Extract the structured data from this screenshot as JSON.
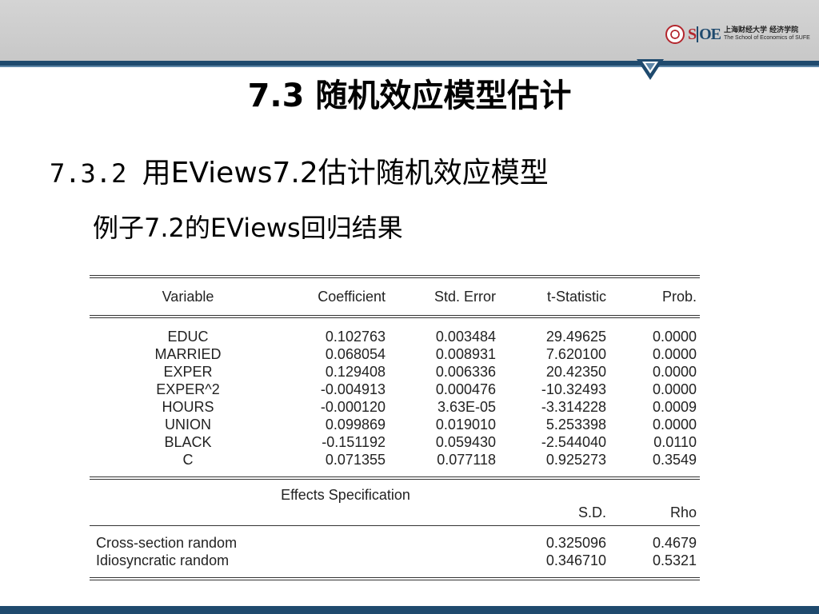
{
  "header": {
    "logo_cn": "上海财经大学 经济学院",
    "logo_en": "The School of Economics of SUFE"
  },
  "slide": {
    "title": "7.3 随机效应模型估计",
    "subtitle_num": "7.3.2 ",
    "subtitle_text": "用EViews7.2估计随机效应模型",
    "caption": "例子7.2的EViews回归结果"
  },
  "table": {
    "headers": {
      "variable": "Variable",
      "coefficient": "Coefficient",
      "std_error": "Std. Error",
      "t_stat": "t-Statistic",
      "prob": "Prob."
    },
    "rows": [
      {
        "variable": "EDUC",
        "coefficient": "0.102763",
        "std_error": "0.003484",
        "t_stat": "29.49625",
        "prob": "0.0000"
      },
      {
        "variable": "MARRIED",
        "coefficient": "0.068054",
        "std_error": "0.008931",
        "t_stat": "7.620100",
        "prob": "0.0000"
      },
      {
        "variable": "EXPER",
        "coefficient": "0.129408",
        "std_error": "0.006336",
        "t_stat": "20.42350",
        "prob": "0.0000"
      },
      {
        "variable": "EXPER^2",
        "coefficient": "-0.004913",
        "std_error": "0.000476",
        "t_stat": "-10.32493",
        "prob": "0.0000"
      },
      {
        "variable": "HOURS",
        "coefficient": "-0.000120",
        "std_error": "3.63E-05",
        "t_stat": "-3.314228",
        "prob": "0.0009"
      },
      {
        "variable": "UNION",
        "coefficient": "0.099869",
        "std_error": "0.019010",
        "t_stat": "5.253398",
        "prob": "0.0000"
      },
      {
        "variable": "BLACK",
        "coefficient": "-0.151192",
        "std_error": "0.059430",
        "t_stat": "-2.544040",
        "prob": "0.0110"
      },
      {
        "variable": "C",
        "coefficient": "0.071355",
        "std_error": "0.077118",
        "t_stat": "0.925273",
        "prob": "0.3549"
      }
    ],
    "effects": {
      "title": "Effects Specification",
      "sd_header": "S.D.",
      "rho_header": "Rho",
      "rows": [
        {
          "label": "Cross-section random",
          "sd": "0.325096",
          "rho": "0.4679"
        },
        {
          "label": "Idiosyncratic random",
          "sd": "0.346710",
          "rho": "0.5321"
        }
      ]
    }
  },
  "colors": {
    "accent_navy": "#1f4a6e",
    "accent_red": "#b3262d",
    "header_gray": "#cccccc"
  }
}
